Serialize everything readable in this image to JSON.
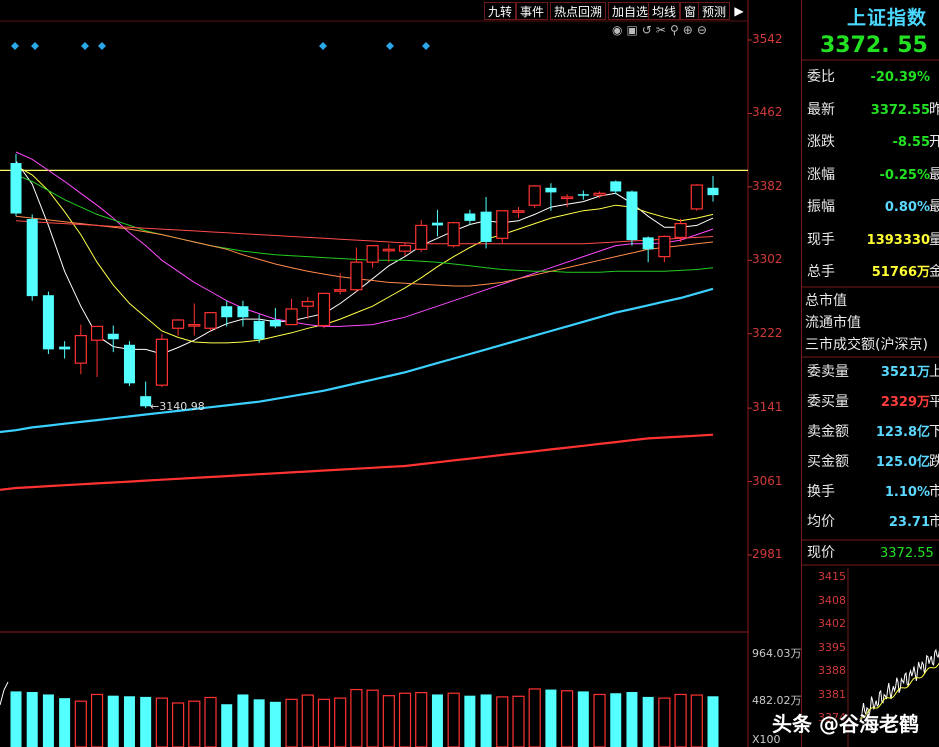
{
  "toolbar": {
    "buttons": [
      "九转",
      "事件",
      "热点回溯",
      "加自选",
      "均线",
      "窗",
      "预测"
    ]
  },
  "index": {
    "name": "上证指数",
    "price": "3372. 55"
  },
  "quote_rows": [
    {
      "label": "委比",
      "value": "-20.39%",
      "color": "grn",
      "extra": ""
    },
    {
      "label": "最新",
      "value": "3372.55",
      "color": "grn",
      "extra": "昨"
    },
    {
      "label": "涨跌",
      "value": "-8.55",
      "color": "grn",
      "extra": "开"
    },
    {
      "label": "涨幅",
      "value": "-0.25%",
      "color": "grn",
      "extra": "最"
    },
    {
      "label": "振幅",
      "value": "0.80%",
      "color": "cyan",
      "extra": "最"
    },
    {
      "label": "现手",
      "value": "1393330",
      "color": "yel",
      "extra": "量"
    },
    {
      "label": "总手",
      "value": "51766万",
      "color": "yel",
      "extra": "金"
    }
  ],
  "market_rows": [
    "总市值",
    "流通市值",
    "三市成交额(沪深京)"
  ],
  "order_rows": [
    {
      "label": "委卖量",
      "value": "3521万",
      "color": "cyan",
      "extra": "上"
    },
    {
      "label": "委买量",
      "value": "2329万",
      "color": "red",
      "extra": "平"
    },
    {
      "label": "卖金额",
      "value": "123.8亿",
      "color": "cyan",
      "extra": "下"
    },
    {
      "label": "买金额",
      "value": "125.0亿",
      "color": "cyan",
      "extra": "跌"
    },
    {
      "label": "换手",
      "value": "1.10%",
      "color": "cyan",
      "extra": "市"
    },
    {
      "label": "均价",
      "value": "23.71",
      "color": "cyan",
      "extra": "市"
    }
  ],
  "current_price": {
    "label": "现价",
    "value": "3372.55"
  },
  "mini_axis": [
    "3415",
    "3408",
    "3402",
    "3395",
    "3388",
    "3381",
    "3374"
  ],
  "main_axis": [
    "3542",
    "3462",
    "3382",
    "3302",
    "3222",
    "3141",
    "3061",
    "2981"
  ],
  "volume_axis": {
    "top": "964.03万",
    "mid": "482.02万",
    "unit": "X100"
  },
  "low_marker": "3140.98",
  "watermark": "头条 @谷海老鹤",
  "colors": {
    "up": "#ff3232",
    "down": "#54ffff",
    "ma5": "#ffffff",
    "ma10": "#ffff4a",
    "ma20": "#ff4aff",
    "ma30": "#22cc22",
    "ma60": "#ff8a4a",
    "ma120": "#3ad0ff",
    "ma250": "#ff3232"
  },
  "chart_data": {
    "type": "candlestick",
    "ylim": [
      2941,
      3560
    ],
    "axis_ticks": [
      3542,
      3462,
      3382,
      3302,
      3222,
      3141,
      3061,
      2981
    ],
    "horizontal_line": 3400,
    "candles": [
      {
        "o": 3408,
        "h": 3418,
        "c": 3353,
        "l": 3350
      },
      {
        "o": 3347,
        "h": 3352,
        "c": 3263,
        "l": 3258
      },
      {
        "o": 3264,
        "h": 3268,
        "c": 3205,
        "l": 3200
      },
      {
        "o": 3208,
        "h": 3214,
        "c": 3205,
        "l": 3195
      },
      {
        "o": 3190,
        "h": 3232,
        "c": 3220,
        "l": 3178
      },
      {
        "o": 3215,
        "h": 3228,
        "c": 3230,
        "l": 3175
      },
      {
        "o": 3222,
        "h": 3231,
        "c": 3216,
        "l": 3202
      },
      {
        "o": 3210,
        "h": 3214,
        "c": 3168,
        "l": 3165
      },
      {
        "o": 3154,
        "h": 3170,
        "c": 3143,
        "l": 3141
      },
      {
        "o": 3166,
        "h": 3222,
        "c": 3216,
        "l": 3164
      },
      {
        "o": 3228,
        "h": 3238,
        "c": 3237,
        "l": 3220
      },
      {
        "o": 3231,
        "h": 3255,
        "c": 3232,
        "l": 3220
      },
      {
        "o": 3228,
        "h": 3245,
        "c": 3245,
        "l": 3225
      },
      {
        "o": 3252,
        "h": 3258,
        "c": 3240,
        "l": 3230
      },
      {
        "o": 3252,
        "h": 3258,
        "c": 3240,
        "l": 3230
      },
      {
        "o": 3236,
        "h": 3243,
        "c": 3216,
        "l": 3212
      },
      {
        "o": 3237,
        "h": 3250,
        "c": 3230,
        "l": 3228
      },
      {
        "o": 3232,
        "h": 3260,
        "c": 3249,
        "l": 3232
      },
      {
        "o": 3252,
        "h": 3262,
        "c": 3257,
        "l": 3238
      },
      {
        "o": 3231,
        "h": 3262,
        "c": 3266,
        "l": 3228
      },
      {
        "o": 3270,
        "h": 3288,
        "c": 3270,
        "l": 3265
      },
      {
        "o": 3270,
        "h": 3316,
        "c": 3300,
        "l": 3268
      },
      {
        "o": 3300,
        "h": 3318,
        "c": 3318,
        "l": 3294
      },
      {
        "o": 3314,
        "h": 3320,
        "c": 3314,
        "l": 3300
      },
      {
        "o": 3312,
        "h": 3321,
        "c": 3318,
        "l": 3307
      },
      {
        "o": 3314,
        "h": 3346,
        "c": 3340,
        "l": 3311
      },
      {
        "o": 3343,
        "h": 3357,
        "c": 3340,
        "l": 3328
      },
      {
        "o": 3318,
        "h": 3344,
        "c": 3343,
        "l": 3316
      },
      {
        "o": 3353,
        "h": 3357,
        "c": 3345,
        "l": 3341
      },
      {
        "o": 3355,
        "h": 3371,
        "c": 3322,
        "l": 3315
      },
      {
        "o": 3326,
        "h": 3355,
        "c": 3356,
        "l": 3320
      },
      {
        "o": 3355,
        "h": 3360,
        "c": 3356,
        "l": 3348
      },
      {
        "o": 3362,
        "h": 3384,
        "c": 3383,
        "l": 3359
      },
      {
        "o": 3381,
        "h": 3386,
        "c": 3376,
        "l": 3356
      },
      {
        "o": 3371,
        "h": 3374,
        "c": 3371,
        "l": 3360
      },
      {
        "o": 3374,
        "h": 3378,
        "c": 3373,
        "l": 3368
      },
      {
        "o": 3373,
        "h": 3377,
        "c": 3375,
        "l": 3370
      },
      {
        "o": 3388,
        "h": 3389,
        "c": 3377,
        "l": 3374
      },
      {
        "o": 3377,
        "h": 3378,
        "c": 3324,
        "l": 3318
      },
      {
        "o": 3327,
        "h": 3328,
        "c": 3314,
        "l": 3300
      },
      {
        "o": 3306,
        "h": 3329,
        "c": 3328,
        "l": 3300
      },
      {
        "o": 3327,
        "h": 3347,
        "c": 3342,
        "l": 3322
      },
      {
        "o": 3358,
        "h": 3385,
        "c": 3384,
        "l": 3356
      },
      {
        "o": 3381,
        "h": 3394,
        "c": 3373,
        "l": 3366
      }
    ],
    "moving_averages": [
      {
        "name": "MA5",
        "color": "#ffffff",
        "points": [
          3410,
          3385,
          3340,
          3290,
          3252,
          3220,
          3208,
          3205,
          3205,
          3200,
          3207,
          3215,
          3225,
          3233,
          3238,
          3238,
          3235,
          3236,
          3240,
          3244,
          3255,
          3268,
          3282,
          3296,
          3306,
          3318,
          3326,
          3334,
          3341,
          3345,
          3343,
          3345,
          3352,
          3360,
          3363,
          3366,
          3372,
          3375,
          3364,
          3350,
          3338,
          3338,
          3340,
          3348
        ]
      },
      {
        "name": "MA10",
        "color": "#ffff4a",
        "points": [
          3405,
          3395,
          3378,
          3355,
          3330,
          3300,
          3275,
          3255,
          3240,
          3225,
          3218,
          3213,
          3212,
          3212,
          3213,
          3215,
          3219,
          3223,
          3228,
          3232,
          3238,
          3245,
          3252,
          3262,
          3272,
          3283,
          3295,
          3306,
          3316,
          3325,
          3330,
          3336,
          3342,
          3348,
          3352,
          3356,
          3358,
          3362,
          3360,
          3354,
          3349,
          3345,
          3348,
          3352
        ]
      },
      {
        "name": "MA20",
        "color": "#ff4aff",
        "points": [
          3420,
          3412,
          3400,
          3388,
          3375,
          3362,
          3348,
          3332,
          3318,
          3302,
          3290,
          3278,
          3268,
          3258,
          3250,
          3244,
          3238,
          3235,
          3232,
          3230,
          3230,
          3231,
          3232,
          3236,
          3240,
          3246,
          3252,
          3258,
          3264,
          3270,
          3276,
          3282,
          3288,
          3294,
          3300,
          3306,
          3312,
          3318,
          3320,
          3320,
          3321,
          3324,
          3330,
          3336
        ]
      },
      {
        "name": "MA30",
        "color": "#22cc22",
        "points": [
          3395,
          3388,
          3378,
          3368,
          3360,
          3352,
          3346,
          3340,
          3334,
          3330,
          3326,
          3322,
          3318,
          3315,
          3312,
          3310,
          3308,
          3307,
          3306,
          3305,
          3304,
          3303,
          3302,
          3302,
          3302,
          3301,
          3300,
          3298,
          3296,
          3294,
          3292,
          3291,
          3290,
          3290,
          3289,
          3289,
          3289,
          3290,
          3290,
          3290,
          3290,
          3291,
          3292,
          3294
        ]
      },
      {
        "name": "MA60",
        "color": "#ff8a4a",
        "points": [
          3350,
          3348,
          3346,
          3344,
          3342,
          3340,
          3338,
          3336,
          3333,
          3330,
          3326,
          3322,
          3318,
          3314,
          3308,
          3303,
          3298,
          3294,
          3290,
          3287,
          3284,
          3282,
          3280,
          3278,
          3277,
          3276,
          3275,
          3274,
          3274,
          3276,
          3278,
          3282,
          3286,
          3290,
          3294,
          3298,
          3302,
          3306,
          3310,
          3314,
          3316,
          3318,
          3320,
          3322
        ]
      },
      {
        "name": "MA_slow",
        "color": "#ff4a4a",
        "points": [
          3345,
          3344,
          3343,
          3342,
          3341,
          3340,
          3339,
          3338,
          3337,
          3336,
          3335,
          3334,
          3333,
          3332,
          3331,
          3330,
          3329,
          3328,
          3327,
          3326,
          3325,
          3324,
          3323,
          3322,
          3321,
          3320,
          3320,
          3320,
          3320,
          3320,
          3320,
          3320,
          3320,
          3320,
          3320,
          3320,
          3321,
          3322,
          3323,
          3324,
          3325,
          3326,
          3327,
          3328
        ]
      },
      {
        "name": "MA120",
        "color": "#3ad0ff",
        "points": [
          3117,
          3120,
          3122,
          3124,
          3126,
          3128,
          3130,
          3132,
          3134,
          3136,
          3138,
          3140,
          3142,
          3144,
          3146,
          3148,
          3151,
          3154,
          3157,
          3160,
          3164,
          3168,
          3172,
          3176,
          3180,
          3185,
          3190,
          3195,
          3200,
          3205,
          3210,
          3215,
          3220,
          3225,
          3230,
          3235,
          3240,
          3245,
          3249,
          3253,
          3257,
          3261,
          3266,
          3271
        ]
      },
      {
        "name": "MA250",
        "color": "#ff3232",
        "points": [
          3054,
          3055,
          3056,
          3057,
          3058,
          3059,
          3060,
          3061,
          3062,
          3063,
          3064,
          3065,
          3066,
          3067,
          3068,
          3069,
          3070,
          3071,
          3072,
          3073,
          3074,
          3075,
          3076,
          3077,
          3078,
          3080,
          3082,
          3084,
          3086,
          3088,
          3090,
          3092,
          3094,
          3096,
          3098,
          3100,
          3102,
          3104,
          3106,
          3108,
          3109,
          3110,
          3111,
          3112
        ]
      }
    ],
    "volume": [
      9.1,
      9.0,
      8.6,
      8.0,
      7.5,
      8.6,
      8.4,
      8.3,
      8.2,
      8.0,
      7.2,
      7.5,
      8.1,
      7.0,
      8.6,
      7.8,
      7.4,
      7.8,
      8.5,
      7.8,
      8.0,
      9.4,
      9.3,
      8.4,
      8.8,
      8.9,
      8.6,
      8.8,
      8.4,
      8.6,
      8.2,
      8.3,
      9.5,
      9.4,
      9.2,
      9.1,
      8.6,
      8.8,
      9.0,
      8.2,
      8.0,
      8.6,
      8.5,
      8.3
    ]
  }
}
